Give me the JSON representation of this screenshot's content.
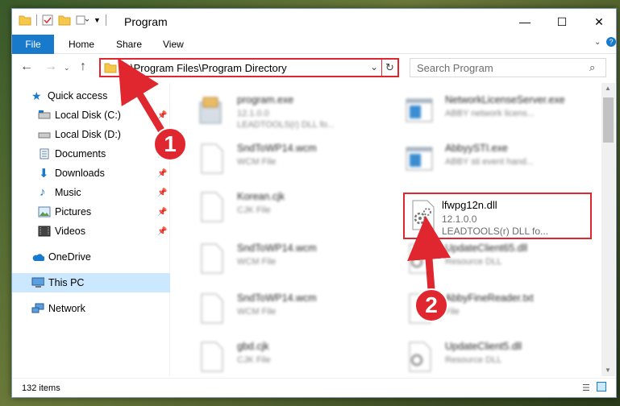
{
  "window": {
    "title": "Program",
    "controls": {
      "minimize": "—",
      "maximize": "☐",
      "close": "✕"
    }
  },
  "ribbon": {
    "file": "File",
    "tabs": [
      "Home",
      "Share",
      "View"
    ]
  },
  "address": {
    "path": "C:\\Program Files\\Program Directory",
    "search_placeholder": "Search Program"
  },
  "navpane": {
    "items": [
      {
        "label": "Quick access",
        "icon": "star-icon"
      },
      {
        "label": "Local Disk (C:)",
        "icon": "drive-icon",
        "pinned": true
      },
      {
        "label": "Local Disk (D:)",
        "icon": "drive-icon",
        "pinned": true
      },
      {
        "label": "Documents",
        "icon": "documents-icon",
        "pinned": true
      },
      {
        "label": "Downloads",
        "icon": "download-icon",
        "pinned": true
      },
      {
        "label": "Music",
        "icon": "music-icon",
        "pinned": true
      },
      {
        "label": "Pictures",
        "icon": "pictures-icon",
        "pinned": true
      },
      {
        "label": "Videos",
        "icon": "videos-icon",
        "pinned": true
      },
      {
        "label": "OneDrive",
        "icon": "cloud-icon"
      },
      {
        "label": "This PC",
        "icon": "computer-icon",
        "selected": true
      },
      {
        "label": "Network",
        "icon": "network-icon"
      }
    ]
  },
  "files": [
    {
      "name": "program.exe",
      "sub": "12.1.0.0",
      "sub2": "LEADTOOLS(r) DLL fo...",
      "icon": "installer-icon"
    },
    {
      "name": "NetworkLicenseServer.exe",
      "sub": "ABBY network licens...",
      "sub2": "",
      "icon": "app-icon"
    },
    {
      "name": "SndToWP14.wcm",
      "sub": "WCM File",
      "sub2": "",
      "icon": "blank-file-icon"
    },
    {
      "name": "AbbyySTI.exe",
      "sub": "ABBY sti event hand...",
      "sub2": "",
      "icon": "app-icon"
    },
    {
      "name": "Korean.cjk",
      "sub": "CJK File",
      "sub2": "",
      "icon": "blank-file-icon"
    },
    {
      "name": "lfwpg12n.dll",
      "sub": "12.1.0.0",
      "sub2": "LEADTOOLS(r) DLL fo...",
      "icon": "dll-gear-icon"
    },
    {
      "name": "SndToWP14.wcm",
      "sub": "WCM File",
      "sub2": "",
      "icon": "blank-file-icon"
    },
    {
      "name": "UpdateClient65.dll",
      "sub": "Resource DLL",
      "sub2": "",
      "icon": "dll-gear-icon"
    },
    {
      "name": "SndToWP14.wcm",
      "sub": "WCM File",
      "sub2": "",
      "icon": "blank-file-icon"
    },
    {
      "name": "AbbyFineReader.txt",
      "sub": "File",
      "sub2": "",
      "icon": "blank-file-icon"
    },
    {
      "name": "gbd.cjk",
      "sub": "CJK File",
      "sub2": "",
      "icon": "blank-file-icon"
    },
    {
      "name": "UpdateClient5.dll",
      "sub": "Resource DLL",
      "sub2": "",
      "icon": "dll-gear-icon"
    }
  ],
  "status": {
    "count": "132 items"
  },
  "annotations": {
    "step1": "1",
    "step2": "2"
  },
  "colors": {
    "accent": "#1979ca",
    "highlight": "#e0272f",
    "selected": "#cce8ff"
  }
}
